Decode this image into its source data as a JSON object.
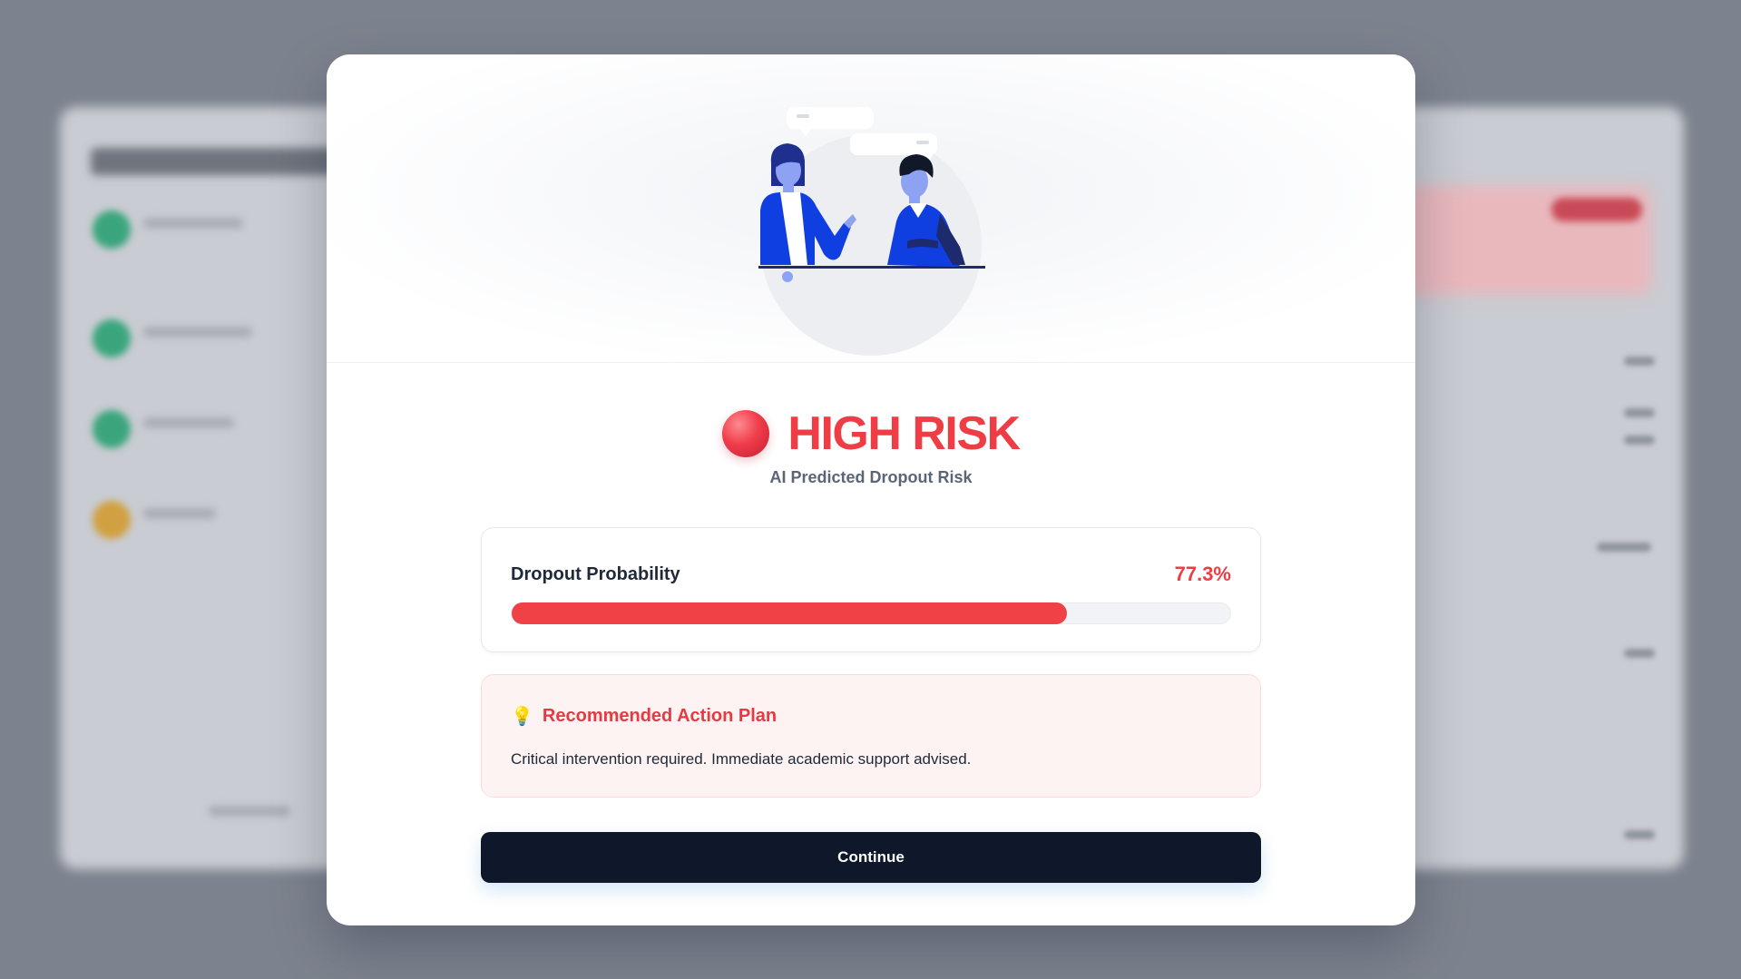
{
  "result": {
    "level": "HIGH RISK",
    "subtitle": "AI Predicted Dropout Risk"
  },
  "probability": {
    "label": "Dropout Probability",
    "value_text": "77.3%",
    "value": 77.3
  },
  "plan": {
    "icon": "lightbulb-icon",
    "title": "Recommended Action Plan",
    "text": "Critical intervention required. Immediate academic support advised."
  },
  "actions": {
    "continue_label": "Continue"
  },
  "colors": {
    "risk": "#ef3d45",
    "progress_fill": "#ef4146",
    "button": "#0f172a"
  }
}
